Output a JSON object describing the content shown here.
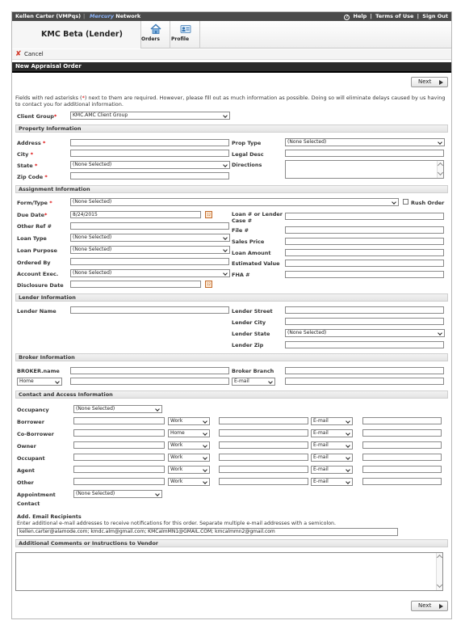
{
  "topbar": {
    "user": "Kellen Carter (VMPqs)",
    "separator": "|",
    "network_brand": "Mercury",
    "network_suffix": "Network",
    "help": "Help",
    "terms": "Terms of Use",
    "signout": "Sign Out",
    "divider": "|"
  },
  "header": {
    "brand": "KMC Beta (Lender)",
    "nav": [
      {
        "label": "Orders",
        "icon": "home-icon"
      },
      {
        "label": "Profile",
        "icon": "profile-card-icon"
      }
    ]
  },
  "toolbar": {
    "cancel_label": "Cancel"
  },
  "page": {
    "title": "New Appraisal Order",
    "next_label": "Next"
  },
  "intro": {
    "part1": "Fields with red asterisks (",
    "asterisk": "*",
    "part2": ") next to them are required. However, please fill out as much information as possible. Doing so will eliminate delays caused by us having to contact you for additional information."
  },
  "client_group": {
    "label": "Client Group",
    "value": "KMC.AMC Client Group"
  },
  "property": {
    "header": "Property Information",
    "address_label": "Address",
    "city_label": "City",
    "state_label": "State",
    "state_value": "(None Selected)",
    "zip_label": "Zip Code",
    "prop_type_label": "Prop Type",
    "prop_type_value": "(None Selected)",
    "legal_label": "Legal Desc",
    "directions_label": "Directions"
  },
  "assignment": {
    "header": "Assignment Information",
    "form_type_label": "Form/Type",
    "form_type_value": "(None Selected)",
    "rush_label": "Rush Order",
    "due_date_label": "Due Date",
    "due_date_value": "8/24/2015",
    "other_ref_label": "Other Ref #",
    "loan_type_label": "Loan Type",
    "loan_type_value": "(None Selected)",
    "loan_purpose_label": "Loan Purpose",
    "loan_purpose_value": "(None Selected)",
    "ordered_by_label": "Ordered By",
    "account_exec_label": "Account Exec.",
    "account_exec_value": "(None Selected)",
    "disclosure_label": "Disclosure Date",
    "loan_num_label_1": "Loan # or Lender",
    "loan_num_label_2": "Case #",
    "file_label": "File #",
    "sales_price_label": "Sales Price",
    "loan_amount_label": "Loan Amount",
    "est_value_label": "Estimated Value",
    "fha_label": "FHA #",
    "cal_glyph": "12"
  },
  "lender": {
    "header": "Lender Information",
    "name_label": "Lender Name",
    "street_label": "Lender Street",
    "city_label": "Lender City",
    "state_label": "Lender State",
    "state_value": "(None Selected)",
    "zip_label": "Lender Zip"
  },
  "broker": {
    "header": "Broker Information",
    "name_label": "BROKER.name",
    "branch_label": "Broker Branch",
    "phone_type": "Home",
    "email_type": "E-mail"
  },
  "contact": {
    "header": "Contact and Access Information",
    "occupancy_label": "Occupancy",
    "occupancy_value": "(None Selected)",
    "rows": [
      {
        "label": "Borrower",
        "phone_type": "Work",
        "email_type": "E-mail"
      },
      {
        "label": "Co-Borrower",
        "phone_type": "Home",
        "email_type": "E-mail"
      },
      {
        "label": "Owner",
        "phone_type": "Work",
        "email_type": "E-mail"
      },
      {
        "label": "Occupant",
        "phone_type": "Work",
        "email_type": "E-mail"
      },
      {
        "label": "Agent",
        "phone_type": "Work",
        "email_type": "E-mail"
      },
      {
        "label": "Other",
        "phone_type": "Work",
        "email_type": "E-mail"
      }
    ],
    "appointment_label_1": "Appointment",
    "appointment_label_2": "Contact",
    "appointment_value": "(None Selected)"
  },
  "emails": {
    "label": "Add. Email Recipients",
    "help": "Enter additional e-mail addresses to receive notifications for this order. Separate multiple e-mail addresses with a semicolon.",
    "value": "kellen.carter@alamode.com; kmdc.alm@gmail.com; KMCalmMN1@GMAIL.COM; kmcalmmn2@gmail.com"
  },
  "comments": {
    "header": "Additional Comments or Instructions to Vendor"
  },
  "colors": {
    "topbar": "#4b4b4b",
    "titlebar": "#2b2b2b",
    "required": "#dd0000",
    "accent_blue": "#8fb8ff"
  }
}
